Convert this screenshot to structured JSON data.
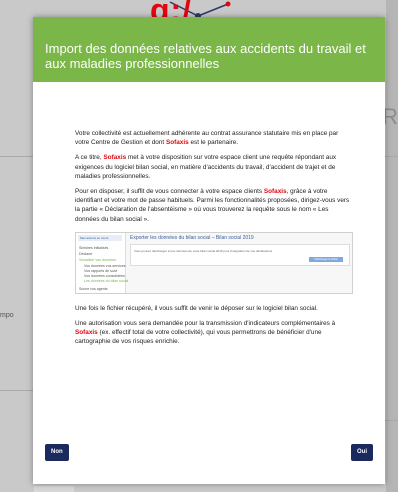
{
  "background": {
    "top_text": "g:/",
    "right_letter": "R",
    "left_text": "mpo"
  },
  "modal": {
    "title": "Import des données relatives aux accidents du travail et aux maladies professionnelles",
    "brand": "Sofaxis",
    "p1": {
      "before": "Votre collectivité est actuellement adhérente au contrat assurance statutaire mis en place par votre Centre de Gestion et dont ",
      "after": " est le partenaire."
    },
    "p2": {
      "before": "A ce titre, ",
      "after": " met à votre disposition sur votre espace client une requête répondant aux exigences du logiciel bilan social, en matière d'accidents du travail, d'accident de trajet et de maladies professionnelles."
    },
    "p3": {
      "before": "Pour en disposer, il suffit de vous connecter à votre espace clients ",
      "after": ", grâce à votre identifiant et votre mot de passe habituels. Parmi les fonctionnalités proposées, dirigez-vous vers la partie « Déclaration de l'absentéisme » où vous trouverez la requête sous le nom « Les données du bilan social »."
    },
    "screenshot": {
      "sidebar_top": "Mes actions en cours",
      "items": [
        "Sinistres initialisés",
        "Déclarer",
        "Visualiser vos données",
        "Vos données vos services",
        "Vos rapports de suivi",
        "Vos données consolidées",
        "Les données du bilan social",
        "Suivre vos agents"
      ],
      "title": "Exporter les données du bilan social – Bilan social 2019",
      "card_text": "Vous pouvez télécharger ici les données de votre bilan social 2019 pour l'intégration de vos déclarations.",
      "card_button": "Télécharger le fichier"
    },
    "p4": "Une fois le fichier récupéré, il vous suffit de venir le déposer sur le logiciel bilan social.",
    "p5": {
      "before": "Une autorisation vous sera demandée pour la transmission d'indicateurs complémentaires à ",
      "after": " (ex. effectif total de votre collectivité), qui vous permettrons de bénéficier d'une cartographie de vos risques enrichie."
    },
    "buttons": {
      "non": "Non",
      "oui": "Oui"
    }
  },
  "colors": {
    "header_green": "#7ab648",
    "brand_red": "#e3050f",
    "button_navy": "#1b2a5e"
  }
}
